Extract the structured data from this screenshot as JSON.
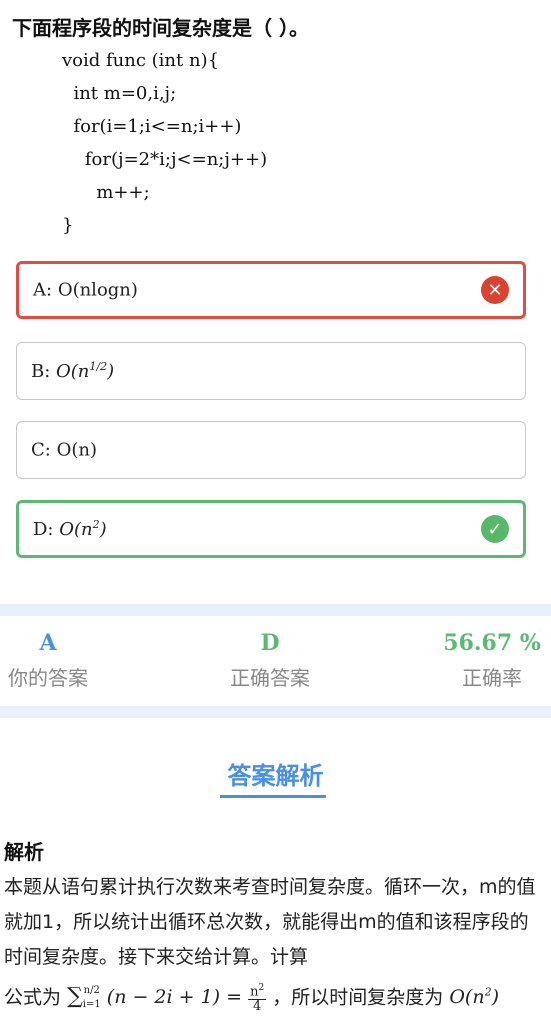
{
  "question": {
    "title": "下面程序段的时间复杂度是（ ）。",
    "code": [
      "void func (int n){",
      "  int m=0,i,j;",
      "  for(i=1;i<=n;i++)",
      "    for(j=2*i;j<=n;j++)",
      "      m++;",
      "}"
    ]
  },
  "options": [
    {
      "letter": "A:",
      "text": "O(nlogn)",
      "state": "wrong"
    },
    {
      "letter": "B:",
      "text": "O(n^(1/2))",
      "state": "normal"
    },
    {
      "letter": "C:",
      "text": "O(n)",
      "state": "normal"
    },
    {
      "letter": "D:",
      "text": "O(n^2)",
      "state": "correct"
    }
  ],
  "stats": {
    "your_answer_value": "A",
    "your_answer_label": "你的答案",
    "correct_answer_value": "D",
    "correct_answer_label": "正确答案",
    "accuracy_value": "56.67 %",
    "accuracy_label": "正确率"
  },
  "analysis": {
    "section_title": "答案解析",
    "heading": "解析",
    "body_line1": "本题从语句累计执行次数来考查时间复杂度。循环一次，m的值就加1，所以统计出循环总次数，就能得出m的值和该程序段的时间复杂度。接下来交给计算。计算",
    "formula_prefix": "公式为",
    "formula_suffix": "，所以时间复杂度为"
  },
  "colors": {
    "wrong": "#e34b3c",
    "correct": "#5cb971",
    "accent": "#4a90e2",
    "band": "#e7f1fb"
  },
  "icons": {
    "wrong": "close-circle-icon",
    "correct": "check-circle-icon"
  }
}
